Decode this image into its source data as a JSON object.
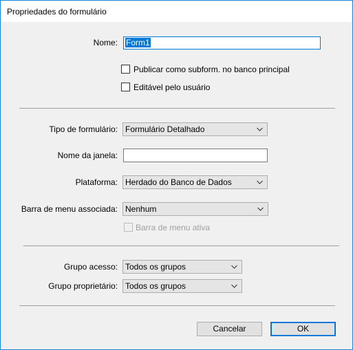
{
  "window": {
    "title": "Propriedades do formulário"
  },
  "form": {
    "name_label": "Nome:",
    "name_value": "Form1",
    "publish_subform_label": "Publicar como subform. no banco principal",
    "publish_subform_checked": false,
    "user_editable_label": "Editável pelo usuário",
    "user_editable_checked": false,
    "form_type_label": "Tipo de formulário:",
    "form_type_value": "Formulário Detalhado",
    "window_name_label": "Nome da janela:",
    "window_name_value": "",
    "platform_label": "Plataforma:",
    "platform_value": "Herdado do Banco de Dados",
    "menubar_label": "Barra de menu associada:",
    "menubar_value": "Nenhum",
    "menubar_active_label": "Barra de menu ativa",
    "menubar_active_checked": false,
    "menubar_active_enabled": false,
    "access_group_label": "Grupo acesso:",
    "access_group_value": "Todos os grupos",
    "owner_group_label": "Grupo proprietário:",
    "owner_group_value": "Todos os grupos"
  },
  "buttons": {
    "cancel_label": "Cancelar",
    "ok_label": "OK"
  },
  "icons": {
    "dropdown": "chevron-down-icon"
  },
  "colors": {
    "accent": "#0078d7",
    "window_border": "#1883d7",
    "dialog_bg": "#f0f0f0"
  }
}
